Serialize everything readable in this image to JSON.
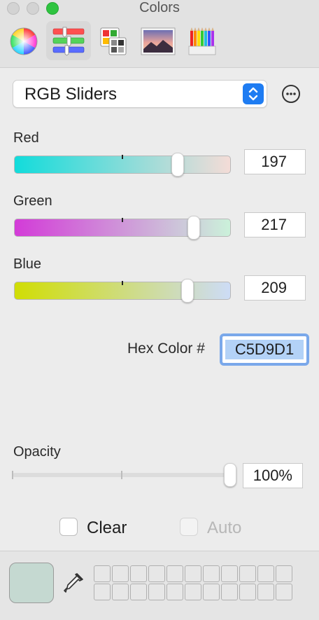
{
  "window": {
    "title": "Colors"
  },
  "toolbar": {
    "tools": [
      {
        "name": "color-wheel"
      },
      {
        "name": "color-sliders",
        "active": true
      },
      {
        "name": "color-palettes"
      },
      {
        "name": "image-palettes"
      },
      {
        "name": "pencils"
      }
    ]
  },
  "mode": {
    "selected": "RGB Sliders"
  },
  "sliders": {
    "red": {
      "label": "Red",
      "value": "197",
      "level": 0.772
    },
    "green": {
      "label": "Green",
      "value": "217",
      "level": 0.851
    },
    "blue": {
      "label": "Blue",
      "value": "209",
      "level": 0.82
    }
  },
  "hex": {
    "label": "Hex Color #",
    "value": "C5D9D1"
  },
  "opacity": {
    "label": "Opacity",
    "value": "100%",
    "level": 1.0
  },
  "checkboxes": {
    "clear": {
      "label": "Clear",
      "checked": false
    },
    "auto": {
      "label": "Auto",
      "checked": false,
      "disabled": true
    }
  },
  "colors": {
    "current": "#C5D9D1",
    "red_track": [
      "#12dcdb",
      "#f4dcd7"
    ],
    "green_track": [
      "#d33bd8",
      "#cbf1da"
    ],
    "blue_track": [
      "#d0dd04",
      "#cddcf6"
    ],
    "accent": "#1e7cf2",
    "hex_focus": "#7aa8ea",
    "hex_selection": "#b3d2f7"
  },
  "swatch_wells": {
    "rows": 2,
    "columns": 11
  }
}
